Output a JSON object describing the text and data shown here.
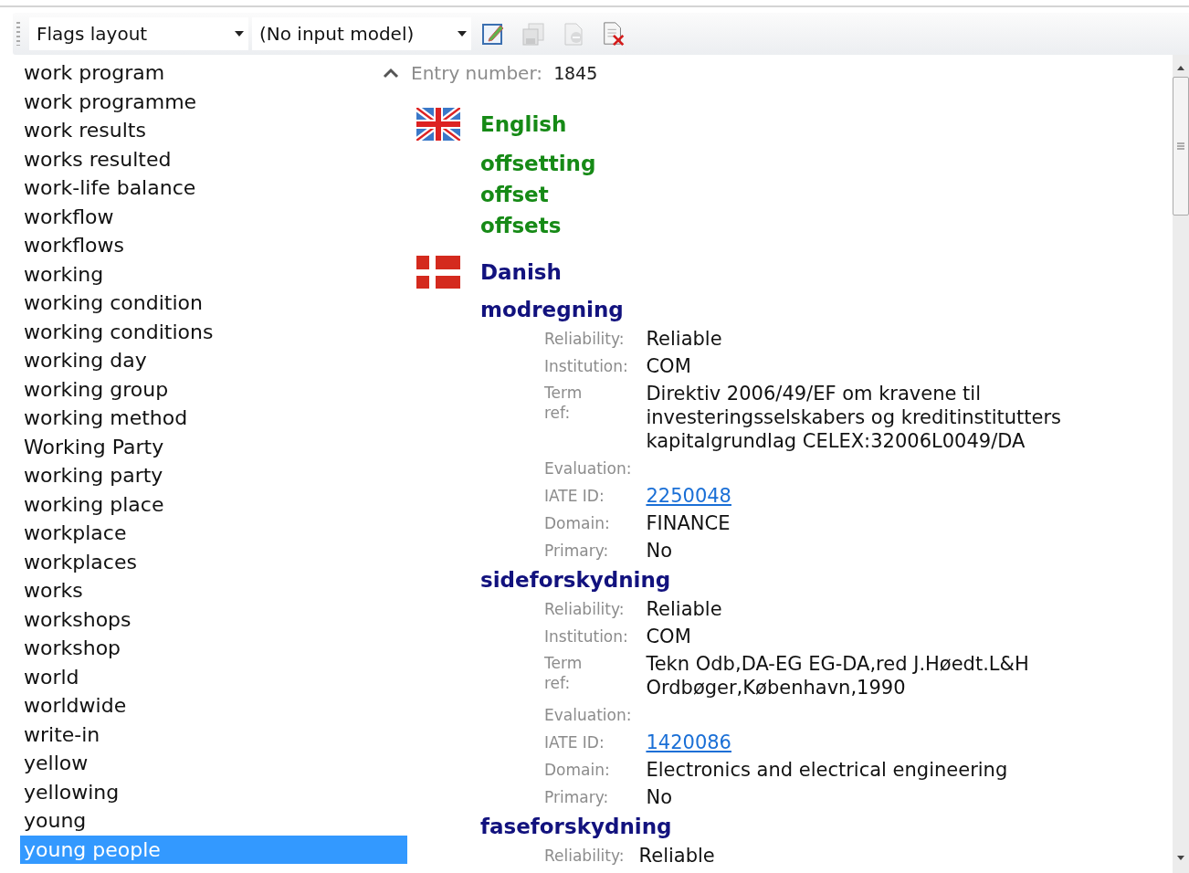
{
  "toolbar": {
    "layout_select": "Flags layout",
    "model_select": "(No input model)",
    "tools": [
      {
        "kind": "edit",
        "disabled": false
      },
      {
        "kind": "save",
        "disabled": true
      },
      {
        "kind": "remove",
        "disabled": true
      },
      {
        "kind": "delete",
        "disabled": false
      }
    ]
  },
  "entries": [
    {
      "label": "work program",
      "selected": false
    },
    {
      "label": "work programme",
      "selected": false
    },
    {
      "label": "work results",
      "selected": false
    },
    {
      "label": "works resulted",
      "selected": false
    },
    {
      "label": "work-life balance",
      "selected": false
    },
    {
      "label": "workflow",
      "selected": false
    },
    {
      "label": "workflows",
      "selected": false
    },
    {
      "label": "working",
      "selected": false
    },
    {
      "label": "working condition",
      "selected": false
    },
    {
      "label": "working conditions",
      "selected": false
    },
    {
      "label": "working day",
      "selected": false
    },
    {
      "label": "working group",
      "selected": false
    },
    {
      "label": "working method",
      "selected": false
    },
    {
      "label": "Working Party",
      "selected": false
    },
    {
      "label": "working party",
      "selected": false
    },
    {
      "label": "working place",
      "selected": false
    },
    {
      "label": "workplace",
      "selected": false
    },
    {
      "label": "workplaces",
      "selected": false
    },
    {
      "label": "works",
      "selected": false
    },
    {
      "label": "workshops",
      "selected": false
    },
    {
      "label": "workshop",
      "selected": false
    },
    {
      "label": "world",
      "selected": false
    },
    {
      "label": "worldwide",
      "selected": false
    },
    {
      "label": "write-in",
      "selected": false
    },
    {
      "label": "yellow",
      "selected": false
    },
    {
      "label": "yellowing",
      "selected": false
    },
    {
      "label": "young",
      "selected": false
    },
    {
      "label": "young people",
      "selected": true
    }
  ],
  "detail": {
    "entry_number_label": "Entry number:",
    "entry_number": "1845",
    "languages": [
      {
        "name": "English",
        "kind": "uk",
        "color": "#168a16",
        "terms": [
          {
            "term": "offsetting"
          },
          {
            "term": "offset"
          },
          {
            "term": "offsets"
          }
        ]
      },
      {
        "name": "Danish",
        "kind": "dk",
        "color": "#12127e",
        "terms": [
          {
            "term": "modregning",
            "fields": [
              {
                "label": "Reliability:",
                "value": "Reliable"
              },
              {
                "label": "Institution:",
                "value": "COM"
              },
              {
                "label": "Term ref:",
                "kind": "multiline",
                "value": "Direktiv 2006/49/EF om kravene til investeringsselskabers og kreditinstitutters kapitalgrundlag CELEX:32006L0049/DA"
              },
              {
                "label": "Evaluation:"
              },
              {
                "label": "IATE ID:",
                "value": "2250048",
                "kind": "link"
              },
              {
                "label": "Domain:",
                "value": "FINANCE"
              },
              {
                "label": "Primary:",
                "value": "No"
              }
            ]
          },
          {
            "term": "sideforskydning",
            "fields": [
              {
                "label": "Reliability:",
                "value": "Reliable"
              },
              {
                "label": "Institution:",
                "value": "COM"
              },
              {
                "label": "Term ref:",
                "kind": "multiline",
                "value": "Tekn Odb,DA-EG EG-DA,red J.Høedt.L&H Ordbøger,København,1990"
              },
              {
                "label": "Evaluation:"
              },
              {
                "label": "IATE ID:",
                "value": "1420086",
                "kind": "link"
              },
              {
                "label": "Domain:",
                "value": "Electronics and electrical engineering"
              },
              {
                "label": "Primary:",
                "value": "No"
              }
            ]
          },
          {
            "term": "faseforskydning",
            "fields": [
              {
                "label": "Reliability:",
                "value": "Reliable"
              }
            ]
          }
        ]
      }
    ]
  }
}
